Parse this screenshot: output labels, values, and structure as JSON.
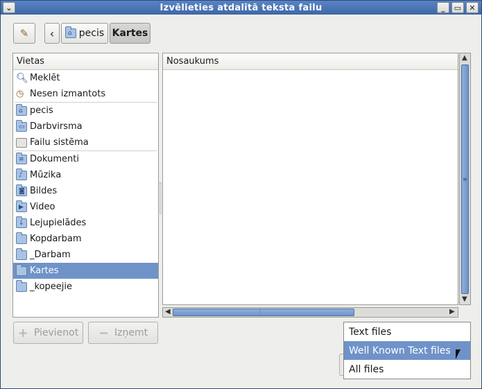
{
  "window": {
    "title": "Izvēlieties atdalītā teksta failu"
  },
  "toolbar": {
    "back_glyph": "‹",
    "path": [
      "pecis",
      "Kartes"
    ]
  },
  "places": {
    "header": "Vietas",
    "items": [
      {
        "label": "Meklēt",
        "icon": "search-icon"
      },
      {
        "label": "Nesen izmantots",
        "icon": "recent-icon"
      },
      {
        "label": "pecis",
        "icon": "home-folder-icon"
      },
      {
        "label": "Darbvirsma",
        "icon": "desktop-folder-icon"
      },
      {
        "label": "Failu sistēma",
        "icon": "drive-icon"
      },
      {
        "label": "Dokumenti",
        "icon": "documents-folder-icon"
      },
      {
        "label": "Mūzika",
        "icon": "music-folder-icon"
      },
      {
        "label": "Bildes",
        "icon": "pictures-folder-icon"
      },
      {
        "label": "Video",
        "icon": "video-folder-icon"
      },
      {
        "label": "Lejupielādes",
        "icon": "downloads-folder-icon"
      },
      {
        "label": "Kopdarbam",
        "icon": "folder-icon"
      },
      {
        "label": "_Darbam",
        "icon": "folder-icon"
      },
      {
        "label": "Kartes",
        "icon": "folder-icon",
        "selected": true
      },
      {
        "label": "_kopeejie",
        "icon": "folder-icon"
      }
    ]
  },
  "files": {
    "header": "Nosaukums"
  },
  "buttons": {
    "add": "Pievienot",
    "remove": "Izņemt"
  },
  "filter": {
    "options": [
      "Text files",
      "Well Known Text files",
      "All files"
    ],
    "highlighted": "Well Known Text files"
  },
  "colors": {
    "accent": "#6f93c9",
    "titlebar": "#4a74b6"
  }
}
